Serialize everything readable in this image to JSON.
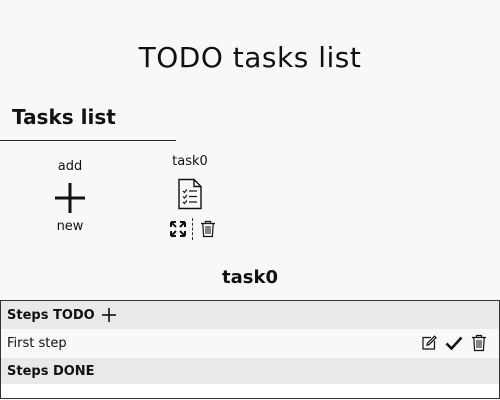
{
  "page": {
    "title": "TODO tasks list"
  },
  "tasks_section": {
    "title": "Tasks list",
    "add_new": {
      "label_top": "add",
      "label_bottom": "new",
      "icon": "plus-icon"
    },
    "tasks": [
      {
        "name": "task0",
        "icon": "task-document-icon",
        "actions": [
          "expand-icon",
          "trash-icon"
        ]
      }
    ]
  },
  "task_detail": {
    "title": "task0",
    "steps_todo": {
      "label": "Steps TODO",
      "add_icon": "plus-icon",
      "items": [
        {
          "text": "First step",
          "actions": [
            "edit-icon",
            "check-icon",
            "trash-icon"
          ]
        }
      ]
    },
    "steps_done": {
      "label": "Steps DONE",
      "items": []
    }
  },
  "colors": {
    "background": "#f8f8f6",
    "panel_header": "#e9e9e7",
    "text": "#111111"
  }
}
